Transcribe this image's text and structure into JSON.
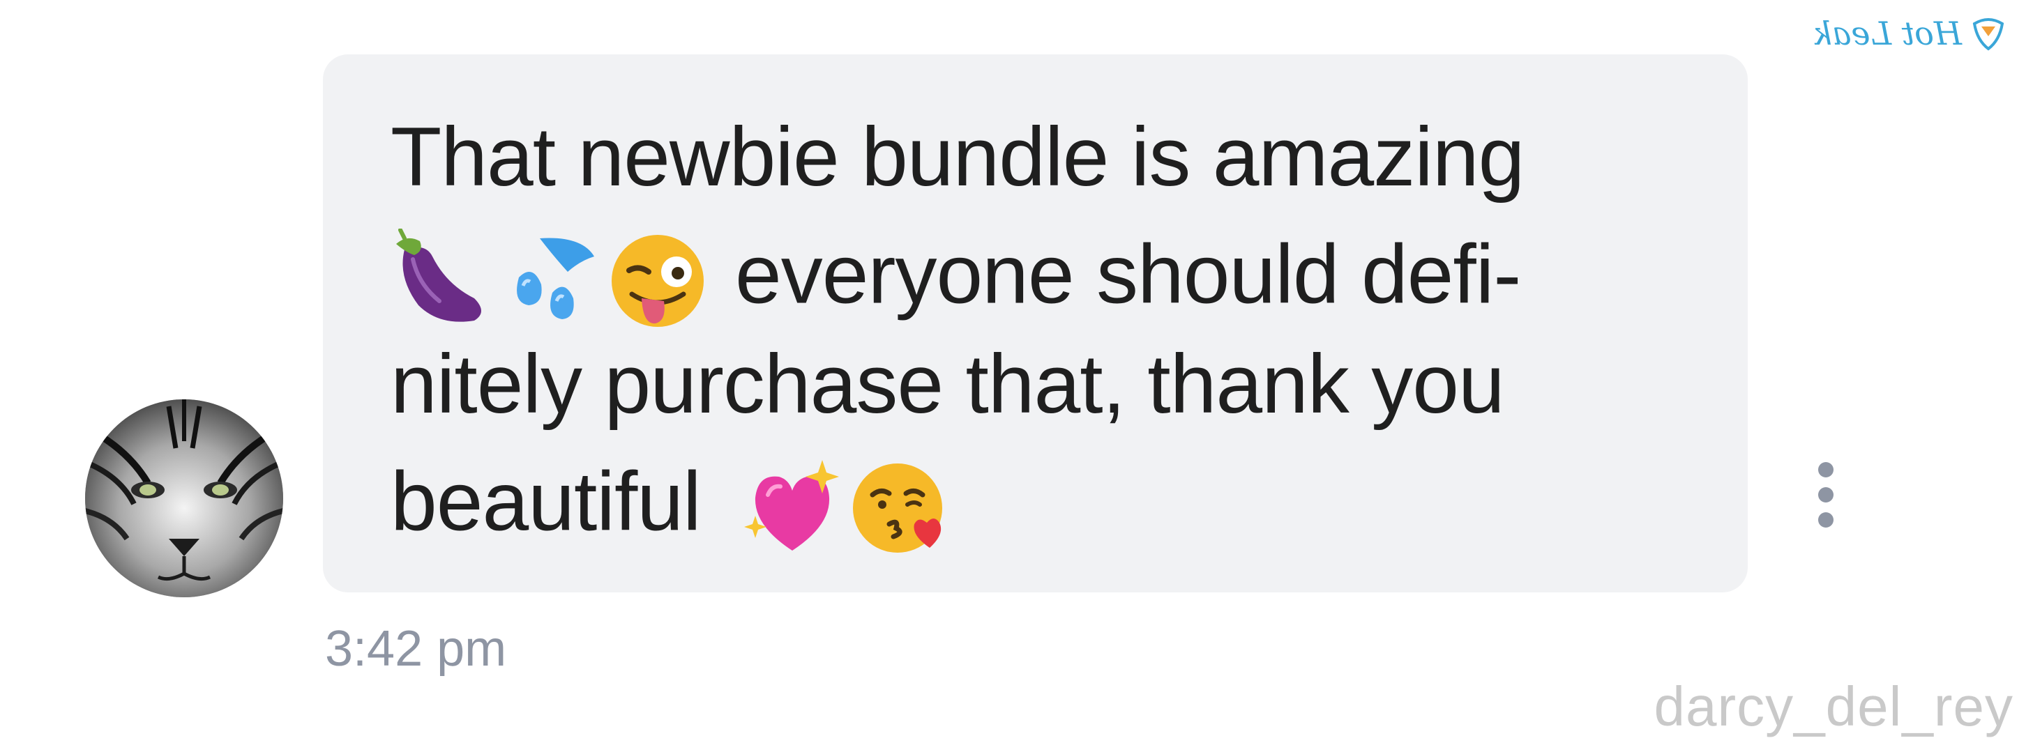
{
  "message": {
    "line1": "That newbie bundle is amazing",
    "line2_emojis": [
      "eggplant-emoji",
      "sweat-droplets-emoji",
      "winking-face-with-tongue-emoji"
    ],
    "line2_text": "everyone should defi-",
    "line3": "nitely purchase that, thank you",
    "line4_text": "beautiful",
    "line4_emojis": [
      "sparkling-heart-emoji",
      "face-blowing-kiss-emoji"
    ]
  },
  "timestamp": "3:42 pm",
  "watermark": {
    "username": "darcy_del_rey",
    "logo_text": "Hot Leak"
  },
  "colors": {
    "bubble": "#f1f2f4",
    "text": "#1f1f1f",
    "meta": "#8e95a3",
    "watermark": "#c9c9c9",
    "logo": "#3aa6d8"
  },
  "icons": {
    "avatar": "tiger-avatar",
    "more": "more-vertical-icon"
  }
}
